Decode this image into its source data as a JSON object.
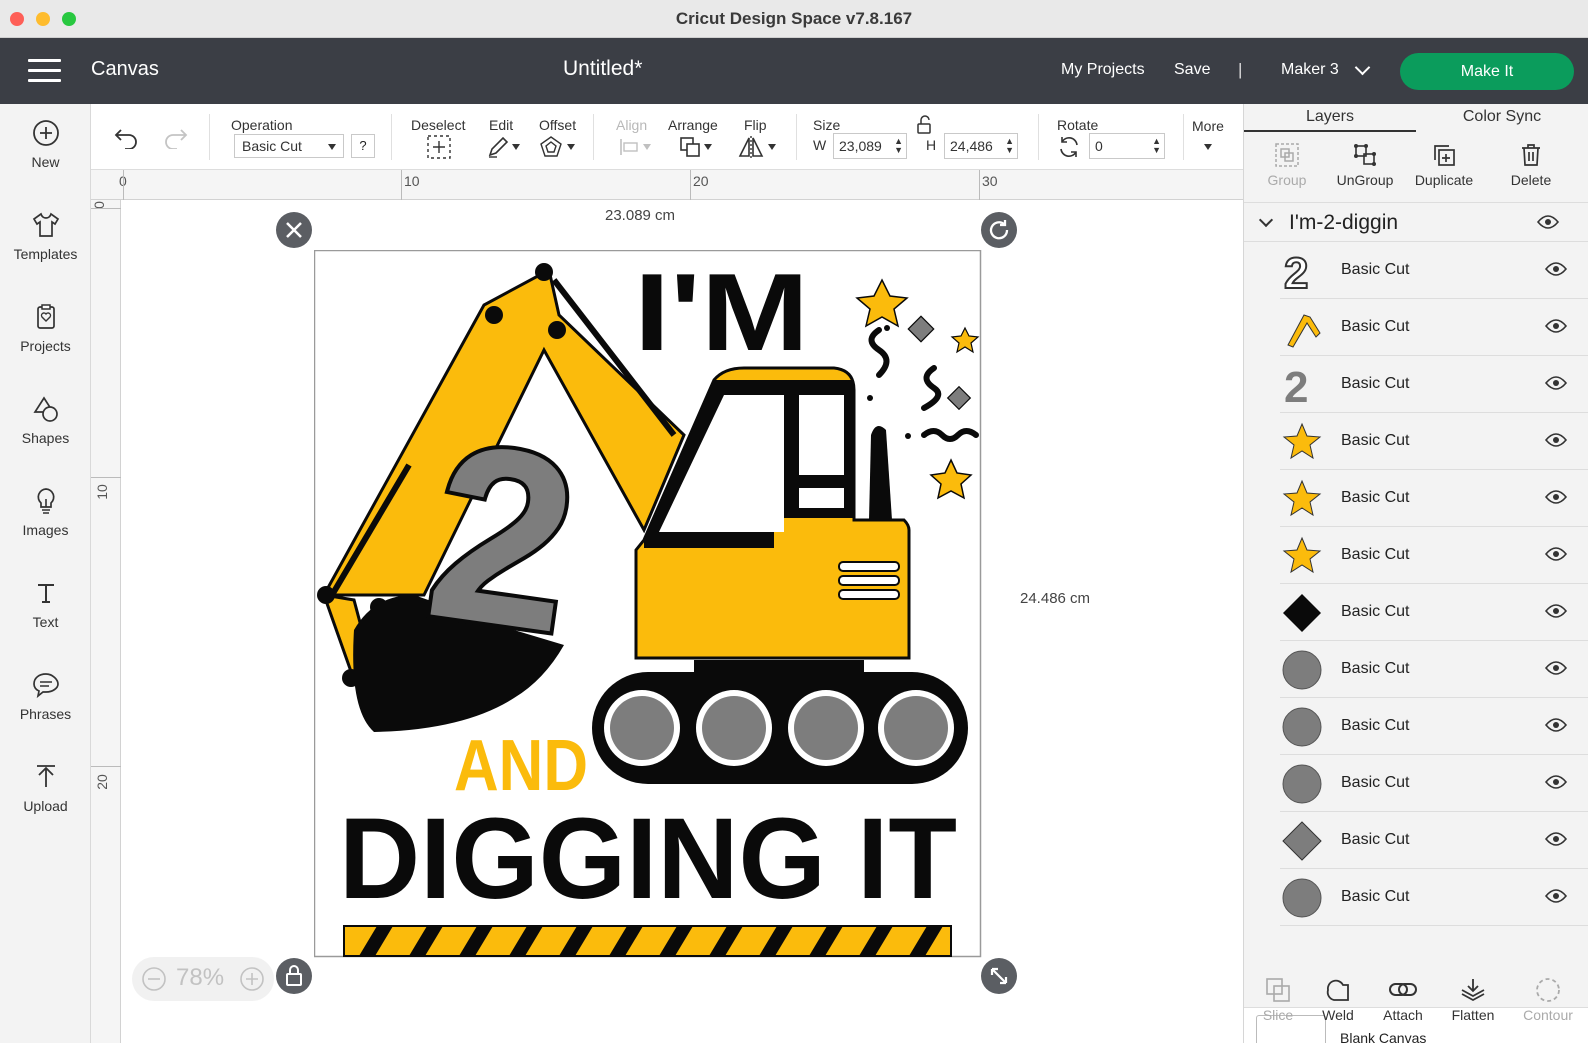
{
  "window": {
    "title": "Cricut Design Space  v7.8.167"
  },
  "header": {
    "menu_icon": "hamburger-menu-icon",
    "section": "Canvas",
    "doc_title": "Untitled*",
    "my_projects": "My Projects",
    "save": "Save",
    "separator": "|",
    "machine": "Maker 3",
    "make_it": "Make It",
    "make_it_color": "#0b9c5c"
  },
  "sidebar": {
    "items": [
      {
        "label": "New",
        "icon": "plus-circle-icon"
      },
      {
        "label": "Templates",
        "icon": "tshirt-icon"
      },
      {
        "label": "Projects",
        "icon": "projects-icon"
      },
      {
        "label": "Shapes",
        "icon": "shapes-icon"
      },
      {
        "label": "Images",
        "icon": "lightbulb-icon"
      },
      {
        "label": "Text",
        "icon": "text-icon"
      },
      {
        "label": "Phrases",
        "icon": "speech-bubble-icon"
      },
      {
        "label": "Upload",
        "icon": "upload-icon"
      }
    ]
  },
  "toolbar": {
    "operation_label": "Operation",
    "operation_value": "Basic Cut",
    "help": "?",
    "deselect": "Deselect",
    "edit": "Edit",
    "offset": "Offset",
    "align": "Align",
    "arrange": "Arrange",
    "flip": "Flip",
    "size_label": "Size",
    "w_label": "W",
    "w_value": "23,089",
    "h_label": "H",
    "h_value": "24,486",
    "rotate_label": "Rotate",
    "rotate_value": "0",
    "more": "More"
  },
  "ruler": {
    "h_labels": [
      "0",
      "10",
      "20",
      "30"
    ],
    "v_labels": [
      "0",
      "10",
      "20"
    ]
  },
  "canvas": {
    "dim_w": "23.089 cm",
    "dim_h": "24.486 cm",
    "zoom": "78%",
    "artwork": {
      "line1": "I'M",
      "number": "2",
      "line2": "AND",
      "line3": "DIGGING IT"
    },
    "colors": {
      "yellow": "#fbbb0c",
      "black": "#0a0a0a",
      "gray": "#7d7d7d"
    }
  },
  "panel": {
    "tabs": [
      "Layers",
      "Color Sync"
    ],
    "actions": {
      "group": "Group",
      "ungroup": "UnGroup",
      "duplicate": "Duplicate",
      "delete": "Delete"
    },
    "group_name": "I'm-2-diggin",
    "layers": [
      {
        "label": "Basic Cut",
        "thumb": "two-outline"
      },
      {
        "label": "Basic Cut",
        "thumb": "arm"
      },
      {
        "label": "Basic Cut",
        "thumb": "two-gray"
      },
      {
        "label": "Basic Cut",
        "thumb": "star"
      },
      {
        "label": "Basic Cut",
        "thumb": "star"
      },
      {
        "label": "Basic Cut",
        "thumb": "star"
      },
      {
        "label": "Basic Cut",
        "thumb": "diamond-black"
      },
      {
        "label": "Basic Cut",
        "thumb": "circle-gray"
      },
      {
        "label": "Basic Cut",
        "thumb": "circle-gray"
      },
      {
        "label": "Basic Cut",
        "thumb": "circle-gray"
      },
      {
        "label": "Basic Cut",
        "thumb": "diamond-gray"
      },
      {
        "label": "Basic Cut",
        "thumb": "circle-gray"
      }
    ],
    "blank_canvas": "Blank Canvas",
    "bottom": {
      "slice": "Slice",
      "weld": "Weld",
      "attach": "Attach",
      "flatten": "Flatten",
      "contour": "Contour"
    }
  }
}
